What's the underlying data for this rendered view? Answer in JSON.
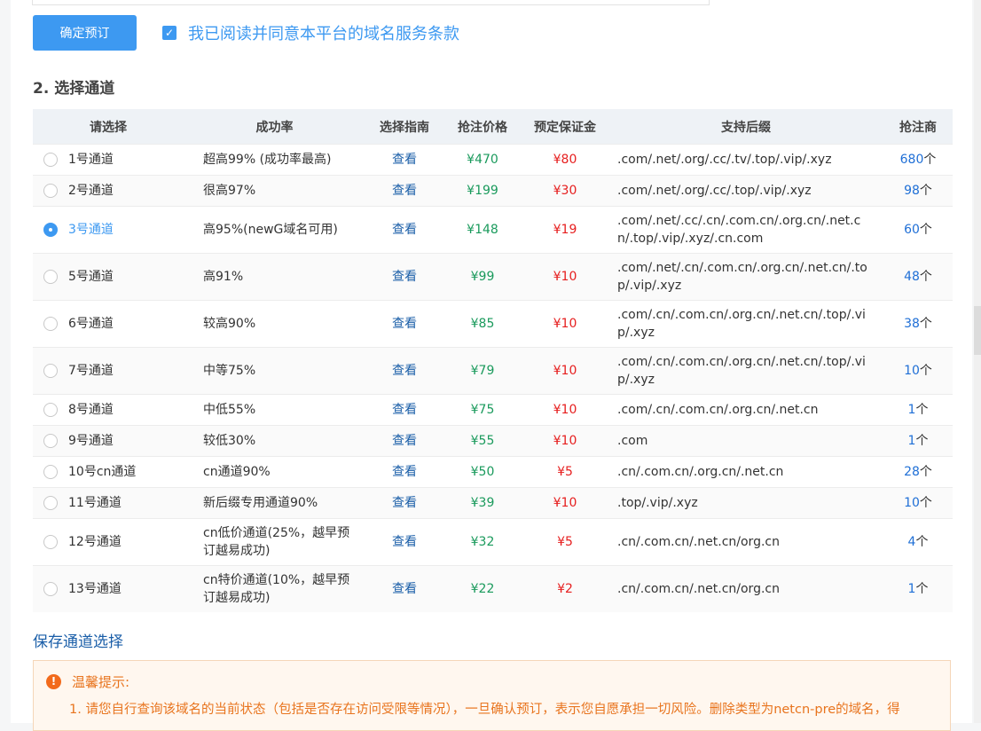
{
  "form": {
    "confirm_label": "确定预订",
    "agree_label": "我已阅读并同意本平台的域名服务条款",
    "section_title": "2. 选择通道"
  },
  "table": {
    "headers": [
      "请选择",
      "成功率",
      "选择指南",
      "抢注价格",
      "预定保证金",
      "支持后缀",
      "抢注商"
    ],
    "rows": [
      {
        "channel": "1号通道",
        "rate": "超高99% (成功率最高)",
        "guide": "查看",
        "price": "¥470",
        "deposit": "¥80",
        "suffixes": ".com/.net/.org/.cc/.tv/.top/.vip/.xyz",
        "merchants": "680",
        "unit": "个",
        "selected": false
      },
      {
        "channel": "2号通道",
        "rate": "很高97%",
        "guide": "查看",
        "price": "¥199",
        "deposit": "¥30",
        "suffixes": ".com/.net/.org/.cc/.top/.vip/.xyz",
        "merchants": "98",
        "unit": "个",
        "selected": false
      },
      {
        "channel": "3号通道",
        "rate": "高95%(newG域名可用)",
        "guide": "查看",
        "price": "¥148",
        "deposit": "¥19",
        "suffixes": ".com/.net/.cc/.cn/.com.cn/.org.cn/.net.cn/.top/.vip/.xyz/.cn.com",
        "merchants": "60",
        "unit": "个",
        "selected": true
      },
      {
        "channel": "5号通道",
        "rate": "高91%",
        "guide": "查看",
        "price": "¥99",
        "deposit": "¥10",
        "suffixes": ".com/.net/.cn/.com.cn/.org.cn/.net.cn/.top/.vip/.xyz",
        "merchants": "48",
        "unit": "个",
        "selected": false
      },
      {
        "channel": "6号通道",
        "rate": "较高90%",
        "guide": "查看",
        "price": "¥85",
        "deposit": "¥10",
        "suffixes": ".com/.cn/.com.cn/.org.cn/.net.cn/.top/.vip/.xyz",
        "merchants": "38",
        "unit": "个",
        "selected": false
      },
      {
        "channel": "7号通道",
        "rate": "中等75%",
        "guide": "查看",
        "price": "¥79",
        "deposit": "¥10",
        "suffixes": ".com/.cn/.com.cn/.org.cn/.net.cn/.top/.vip/.xyz",
        "merchants": "10",
        "unit": "个",
        "selected": false
      },
      {
        "channel": "8号通道",
        "rate": "中低55%",
        "guide": "查看",
        "price": "¥75",
        "deposit": "¥10",
        "suffixes": ".com/.cn/.com.cn/.org.cn/.net.cn",
        "merchants": "1",
        "unit": "个",
        "selected": false
      },
      {
        "channel": "9号通道",
        "rate": "较低30%",
        "guide": "查看",
        "price": "¥55",
        "deposit": "¥10",
        "suffixes": ".com",
        "merchants": "1",
        "unit": "个",
        "selected": false
      },
      {
        "channel": "10号cn通道",
        "rate": "cn通道90%",
        "guide": "查看",
        "price": "¥50",
        "deposit": "¥5",
        "suffixes": ".cn/.com.cn/.org.cn/.net.cn",
        "merchants": "28",
        "unit": "个",
        "selected": false
      },
      {
        "channel": "11号通道",
        "rate": "新后缀专用通道90%",
        "guide": "查看",
        "price": "¥39",
        "deposit": "¥10",
        "suffixes": ".top/.vip/.xyz",
        "merchants": "10",
        "unit": "个",
        "selected": false
      },
      {
        "channel": "12号通道",
        "rate": "cn低价通道(25%，越早预订越易成功)",
        "guide": "查看",
        "price": "¥32",
        "deposit": "¥5",
        "suffixes": ".cn/.com.cn/.net.cn/org.cn",
        "merchants": "4",
        "unit": "个",
        "selected": false
      },
      {
        "channel": "13号通道",
        "rate": "cn特价通道(10%，越早预订越易成功)",
        "guide": "查看",
        "price": "¥22",
        "deposit": "¥2",
        "suffixes": ".cn/.com.cn/.net.cn/org.cn",
        "merchants": "1",
        "unit": "个",
        "selected": false
      }
    ]
  },
  "save_label": "保存通道选择",
  "tips": {
    "title": "温馨提示:",
    "line1": "1. 请您自行查询该域名的当前状态（包括是否存在访问受限等情况），一旦确认预订，表示您自愿承担一切风险。删除类型为netcn-pre的域名，得"
  },
  "colors": {
    "accent": "#3d99f1",
    "price": "#1a9a5c",
    "deposit": "#e61e1e",
    "warning": "#e8741e"
  }
}
